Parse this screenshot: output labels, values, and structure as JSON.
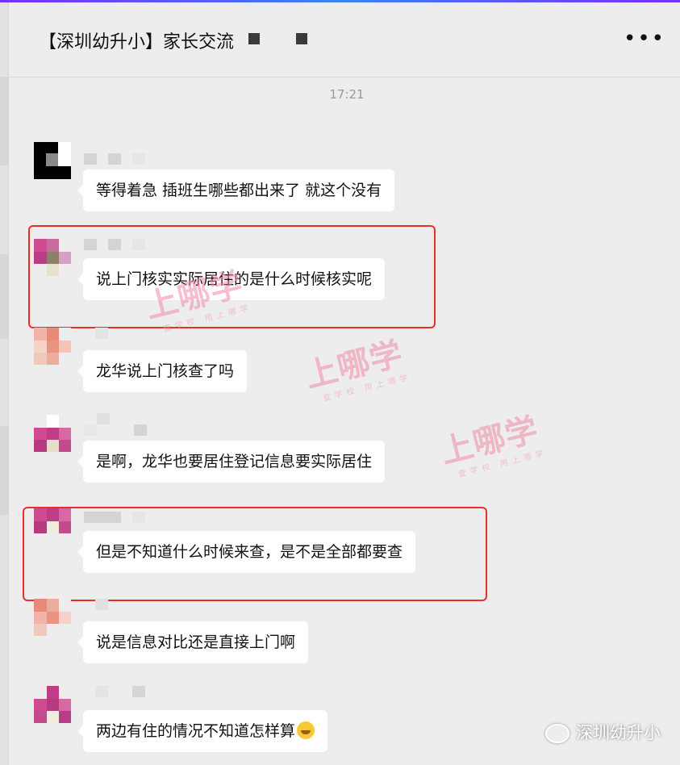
{
  "header": {
    "title": "【深圳幼升小】家长交流",
    "more_label": "•••"
  },
  "timestamp": "17:21",
  "messages": [
    {
      "text": "等得着急 插班生哪些都出来了 就这个没有",
      "highlighted": false
    },
    {
      "text": "说上门核实实际居住的是什么时候核实呢",
      "highlighted": true
    },
    {
      "text": "龙华说上门核查了吗",
      "highlighted": false
    },
    {
      "text": "是啊，龙华也要居住登记信息要实际居住",
      "highlighted": false
    },
    {
      "text": "但是不知道什么时候来查，是不是全部都要查",
      "highlighted": true
    },
    {
      "text": "说是信息对比还是直接上门啊",
      "highlighted": false
    },
    {
      "text": "两边有住的情况不知道怎样算",
      "emoji": "face-emoji",
      "highlighted": false
    }
  ],
  "watermark": {
    "main": "上哪学",
    "sub": "查学校  用上哪学"
  },
  "footer": {
    "icon": "wechat-icon",
    "account": "深圳幼升小"
  },
  "colors": {
    "highlight": "#e8302a",
    "watermark": "#f28aa8",
    "bubble": "#ffffff",
    "background": "#ededed"
  }
}
